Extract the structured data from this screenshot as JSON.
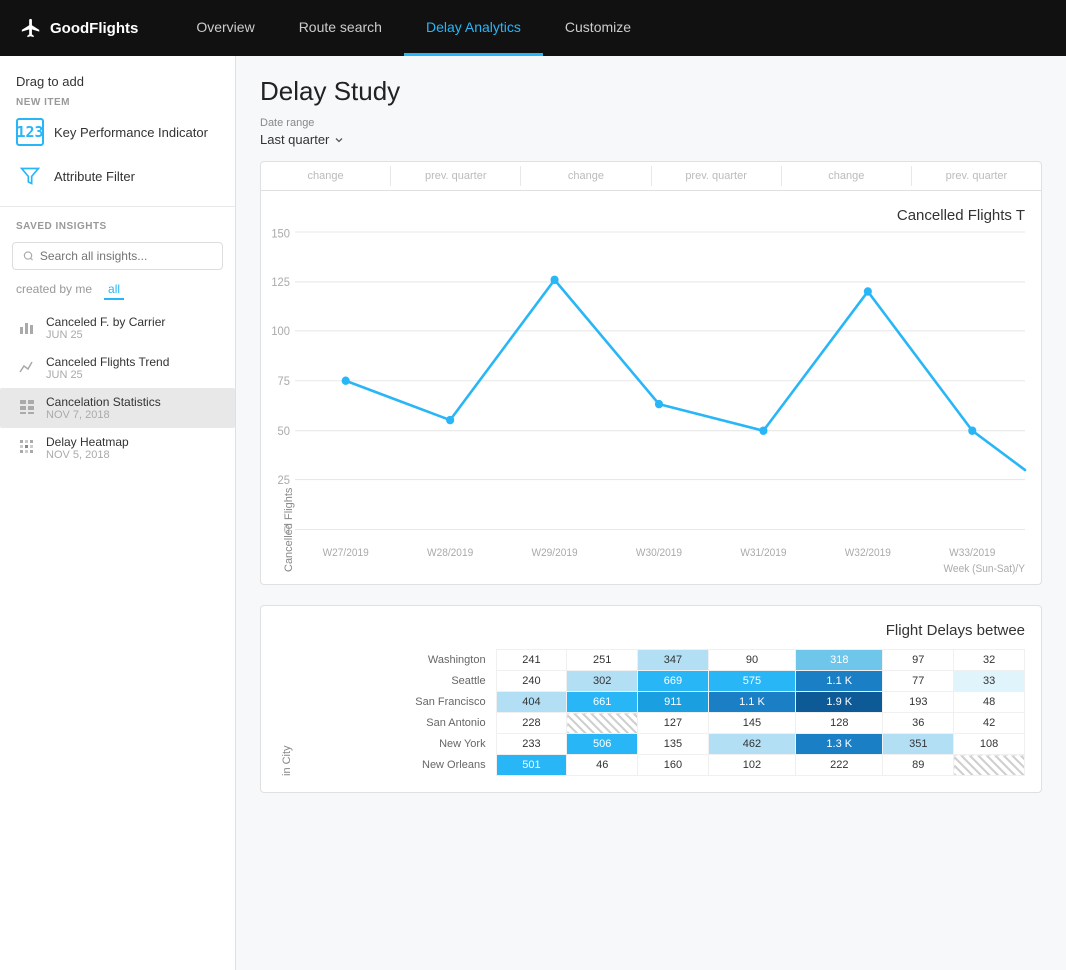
{
  "nav": {
    "logo": "GoodFlights",
    "tabs": [
      {
        "label": "Overview",
        "active": false
      },
      {
        "label": "Route search",
        "active": false
      },
      {
        "label": "Delay Analytics",
        "active": true
      },
      {
        "label": "Customize",
        "active": false
      }
    ]
  },
  "sidebar": {
    "drag_label": "Drag to add",
    "new_item_label": "NEW ITEM",
    "items": [
      {
        "icon": "kpi-icon",
        "label": "Key Performance Indicator"
      },
      {
        "icon": "filter-icon",
        "label": "Attribute Filter"
      }
    ],
    "saved_insights_label": "SAVED INSIGHTS",
    "search_placeholder": "Search all insights...",
    "filter_tabs": [
      {
        "label": "created by me",
        "active": false
      },
      {
        "label": "all",
        "active": true
      }
    ],
    "insights": [
      {
        "icon": "bar-icon",
        "name": "Canceled F. by Carrier",
        "date": "JUN 25",
        "active": false
      },
      {
        "icon": "trend-icon",
        "name": "Canceled Flights Trend",
        "date": "JUN 25",
        "active": false
      },
      {
        "icon": "table-icon",
        "name": "Cancelation Statistics",
        "date": "NOV 7, 2018",
        "active": true
      },
      {
        "icon": "heatmap-icon",
        "name": "Delay Heatmap",
        "date": "NOV 5, 2018",
        "active": false
      }
    ]
  },
  "main": {
    "title": "Delay Study",
    "date_range_label": "Date range",
    "date_range_value": "Last quarter",
    "metrics_cols": [
      "change",
      "prev. quarter",
      "change",
      "prev. quarter",
      "change",
      "prev. quarter"
    ],
    "chart": {
      "title": "Cancelled Flights T",
      "y_label": "Cancelled Flights",
      "x_axis_label": "Week (Sun-Sat)/Y",
      "y_ticks": [
        0,
        25,
        50,
        75,
        100,
        125,
        150
      ],
      "x_labels": [
        "W27/2019",
        "W28/2019",
        "W29/2019",
        "W30/2019",
        "W31/2019",
        "W32/2019",
        "W33/2019"
      ],
      "data_points": [
        75,
        55,
        126,
        63,
        50,
        120,
        50,
        30
      ]
    },
    "heatmap": {
      "title": "Flight Delays betwee",
      "y_axis_label": "in City",
      "rows": [
        {
          "label": "Washington",
          "values": [
            241,
            251,
            347,
            90,
            318,
            97,
            32
          ]
        },
        {
          "label": "Seattle",
          "values": [
            240,
            302,
            669,
            575,
            "1.1 K",
            77,
            33
          ]
        },
        {
          "label": "San Francisco",
          "values": [
            404,
            661,
            911,
            "1.1 K",
            "1.9 K",
            193,
            48
          ]
        },
        {
          "label": "San Antonio",
          "values": [
            228,
            null,
            127,
            145,
            128,
            36,
            42
          ]
        },
        {
          "label": "New York",
          "values": [
            233,
            506,
            135,
            462,
            "1.3 K",
            351,
            108
          ]
        },
        {
          "label": "New Orleans",
          "values": [
            501,
            46,
            160,
            102,
            222,
            89,
            null
          ]
        }
      ]
    }
  }
}
